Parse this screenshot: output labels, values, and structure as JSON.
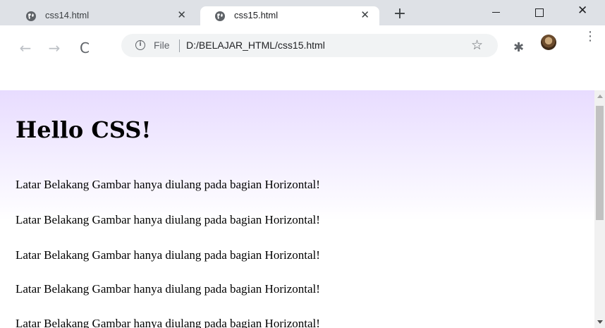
{
  "tabs": [
    {
      "title": "css14.html",
      "close": "✕",
      "active": false
    },
    {
      "title": "css15.html",
      "close": "✕",
      "active": true
    }
  ],
  "new_tab_label": "+",
  "window_controls": {
    "close": "✕"
  },
  "toolbar": {
    "back": "←",
    "forward": "→",
    "reload": "C",
    "info": "i",
    "scheme": "File",
    "url": "D:/BELAJAR_HTML/css15.html",
    "star": "☆",
    "extensions": "✱",
    "menu": "⋮"
  },
  "page": {
    "heading": "Hello CSS!",
    "paragraphs": [
      "Latar Belakang Gambar hanya diulang pada bagian Horizontal!",
      "Latar Belakang Gambar hanya diulang pada bagian Horizontal!",
      "Latar Belakang Gambar hanya diulang pada bagian Horizontal!",
      "Latar Belakang Gambar hanya diulang pada bagian Horizontal!",
      "Latar Belakang Gambar hanya diulang pada bagian Horizontal!"
    ]
  },
  "colors": {
    "page_gradient_top": "#e8dcff",
    "tabstrip_bg": "#dee1e6"
  }
}
